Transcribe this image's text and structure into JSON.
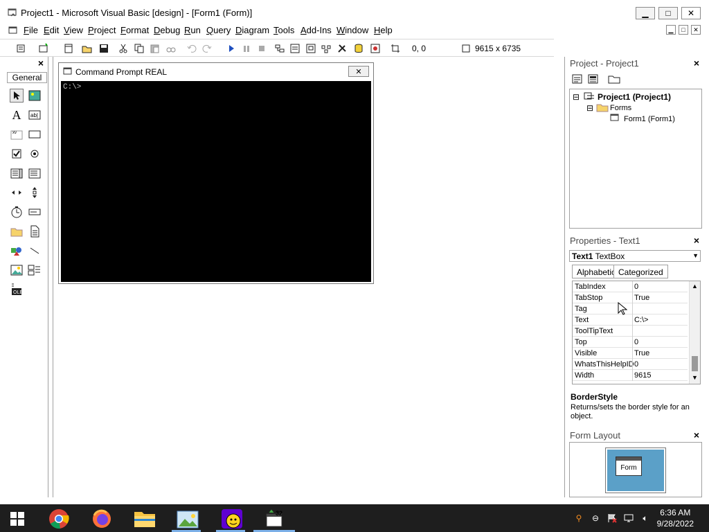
{
  "window": {
    "title": "Project1 - Microsoft Visual Basic [design] - [Form1 (Form)]",
    "min_glyph": "▁",
    "max_glyph": "□",
    "close_glyph": "✕"
  },
  "menu": [
    {
      "key": "F",
      "rest": "ile"
    },
    {
      "key": "E",
      "rest": "dit"
    },
    {
      "key": "V",
      "rest": "iew"
    },
    {
      "key": "P",
      "rest": "roject"
    },
    {
      "key": "F",
      "rest": "ormat",
      "pre": ""
    },
    {
      "key": "D",
      "rest": "ebug"
    },
    {
      "key": "R",
      "rest": "un"
    },
    {
      "key": "Q",
      "rest": "uery"
    },
    {
      "key": "D",
      "rest": "iagram",
      "pre": ""
    },
    {
      "key": "T",
      "rest": "ools"
    },
    {
      "key": "A",
      "rest": "dd-Ins"
    },
    {
      "key": "W",
      "rest": "indow"
    },
    {
      "key": "H",
      "rest": "elp"
    }
  ],
  "toolbar": {
    "position": "0, 0",
    "size": "9615 x 6735"
  },
  "toolbox": {
    "title": "General"
  },
  "form": {
    "caption": "Command Prompt REAL",
    "console_text": "C:\\>"
  },
  "project": {
    "title": "Project - Project1",
    "root": "Project1 (Project1)",
    "folder": "Forms",
    "item": "Form1 (Form1)"
  },
  "properties": {
    "title": "Properties - Text1",
    "object_name": "Text1",
    "object_type": "TextBox",
    "tab_alpha": "Alphabetic",
    "tab_cat": "Categorized",
    "rows": [
      {
        "k": "TabIndex",
        "v": "0"
      },
      {
        "k": "TabStop",
        "v": "True"
      },
      {
        "k": "Tag",
        "v": ""
      },
      {
        "k": "Text",
        "v": "C:\\>"
      },
      {
        "k": "ToolTipText",
        "v": ""
      },
      {
        "k": "Top",
        "v": "0"
      },
      {
        "k": "Visible",
        "v": "True"
      },
      {
        "k": "WhatsThisHelpID",
        "v": "0"
      },
      {
        "k": "Width",
        "v": "9615"
      }
    ],
    "desc_title": "BorderStyle",
    "desc_text": "Returns/sets the border style for an object."
  },
  "form_layout": {
    "title": "Form Layout",
    "label": "Form"
  },
  "taskbar": {
    "time": "6:36 AM",
    "date": "9/28/2022"
  }
}
